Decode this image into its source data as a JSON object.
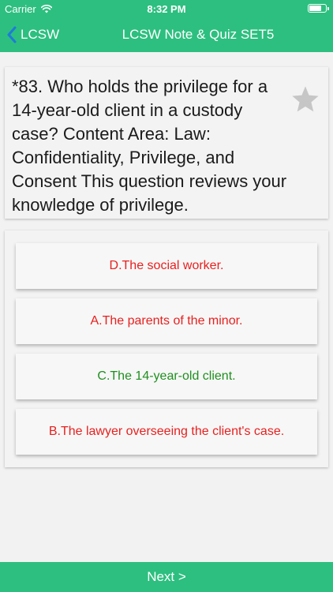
{
  "status_bar": {
    "carrier": "Carrier",
    "time": "8:32 PM"
  },
  "navbar": {
    "back_label": "LCSW",
    "title": "LCSW Note & Quiz SET5"
  },
  "question": {
    "text": "*83. Who holds the privilege for a 14-year-old client in a custody case?   Content Area: Law: Confidentiality, Privilege, and Consent This question reviews your knowledge of privilege."
  },
  "answers": [
    {
      "label": "D.The social worker.",
      "color": "#e8201f"
    },
    {
      "label": "A.The parents of the minor.",
      "color": "#e8201f"
    },
    {
      "label": "C.The 14-year-old client.",
      "color": "#1f8f1f"
    },
    {
      "label": "B.The lawyer overseeing the client's case.",
      "color": "#e8201f"
    }
  ],
  "footer": {
    "next_label": "Next >"
  },
  "colors": {
    "accent": "#2dbf7f",
    "incorrect": "#e8201f",
    "correct": "#1f8f1f",
    "star": "#c6c6c6"
  },
  "icons": {
    "back": "chevron-left-icon",
    "favorite": "star-icon",
    "wifi": "wifi-icon",
    "battery": "battery-icon"
  }
}
